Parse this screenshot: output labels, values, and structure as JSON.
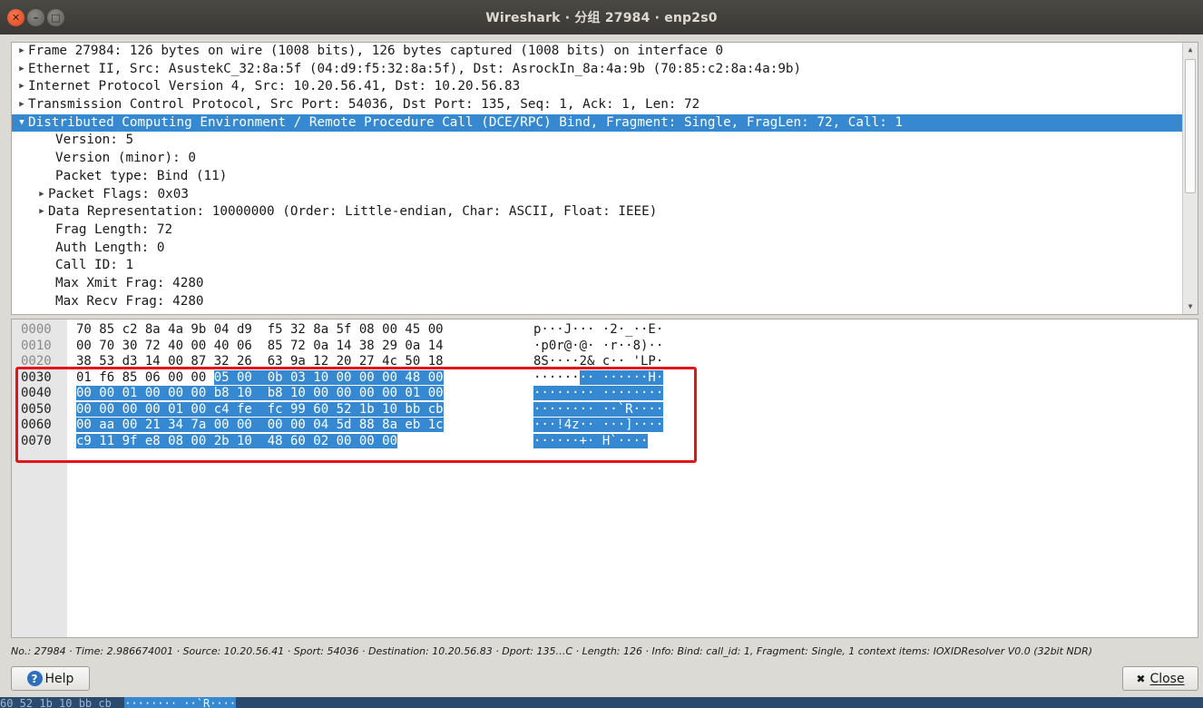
{
  "window": {
    "title": "Wireshark · 分组 27984 · enp2s0"
  },
  "tree": {
    "rows": [
      {
        "level": 0,
        "expander": "collapsed",
        "text": "Frame 27984: 126 bytes on wire (1008 bits), 126 bytes captured (1008 bits) on interface 0"
      },
      {
        "level": 0,
        "expander": "collapsed",
        "text": "Ethernet II, Src: AsustekC_32:8a:5f (04:d9:f5:32:8a:5f), Dst: AsrockIn_8a:4a:9b (70:85:c2:8a:4a:9b)"
      },
      {
        "level": 0,
        "expander": "collapsed",
        "text": "Internet Protocol Version 4, Src: 10.20.56.41, Dst: 10.20.56.83"
      },
      {
        "level": 0,
        "expander": "collapsed",
        "text": "Transmission Control Protocol, Src Port: 54036, Dst Port: 135, Seq: 1, Ack: 1, Len: 72"
      },
      {
        "level": 0,
        "expander": "expanded",
        "selected": true,
        "text": "Distributed Computing Environment / Remote Procedure Call (DCE/RPC) Bind, Fragment: Single, FragLen: 72, Call: 1"
      },
      {
        "level": 1,
        "expander": "none",
        "text": "Version: 5"
      },
      {
        "level": 1,
        "expander": "none",
        "text": "Version (minor): 0"
      },
      {
        "level": 1,
        "expander": "none",
        "text": "Packet type: Bind (11)"
      },
      {
        "level": 1,
        "expander": "collapsed",
        "text": "Packet Flags: 0x03"
      },
      {
        "level": 1,
        "expander": "collapsed",
        "text": "Data Representation: 10000000 (Order: Little-endian, Char: ASCII, Float: IEEE)"
      },
      {
        "level": 1,
        "expander": "none",
        "text": "Frag Length: 72"
      },
      {
        "level": 1,
        "expander": "none",
        "text": "Auth Length: 0"
      },
      {
        "level": 1,
        "expander": "none",
        "text": "Call ID: 1"
      },
      {
        "level": 1,
        "expander": "none",
        "text": "Max Xmit Frag: 4280"
      },
      {
        "level": 1,
        "expander": "none",
        "text": "Max Recv Frag: 4280"
      }
    ]
  },
  "hex": {
    "rows": [
      {
        "offset": "0000",
        "bytes_plain": "70 85 c2 8a 4a 9b 04 d9  f5 32 8a 5f 08 00 45 00",
        "bytes_hl": "",
        "ascii_plain": "p···J··· ·2·_··E·",
        "ascii_hl": ""
      },
      {
        "offset": "0010",
        "bytes_plain": "00 70 30 72 40 00 40 06  85 72 0a 14 38 29 0a 14",
        "bytes_hl": "",
        "ascii_plain": "·p0r@·@· ·r··8)··",
        "ascii_hl": ""
      },
      {
        "offset": "0020",
        "bytes_plain": "38 53 d3 14 00 87 32 26  63 9a 12 20 27 4c 50 18",
        "bytes_hl": "",
        "ascii_plain": "8S····2& c·· 'LP·",
        "ascii_hl": ""
      },
      {
        "offset": "0030",
        "bytes_plain": "01 f6 85 06 00 00 ",
        "bytes_hl": "05 00  0b 03 10 00 00 00 48 00",
        "ascii_plain": "······",
        "ascii_hl": "·· ······H·"
      },
      {
        "offset": "0040",
        "bytes_plain": "",
        "bytes_hl": "00 00 01 00 00 00 b8 10  b8 10 00 00 00 00 01 00",
        "ascii_plain": "",
        "ascii_hl": "········ ········"
      },
      {
        "offset": "0050",
        "bytes_plain": "",
        "bytes_hl": "00 00 00 00 01 00 c4 fe  fc 99 60 52 1b 10 bb cb",
        "ascii_plain": "",
        "ascii_hl": "········ ··`R····"
      },
      {
        "offset": "0060",
        "bytes_plain": "",
        "bytes_hl": "00 aa 00 21 34 7a 00 00  00 00 04 5d 88 8a eb 1c",
        "ascii_plain": "",
        "ascii_hl": "···!4z·· ···]····"
      },
      {
        "offset": "0070",
        "bytes_plain": "",
        "bytes_hl": "c9 11 9f e8 08 00 2b 10  48 60 02 00 00 00",
        "ascii_plain": "",
        "ascii_hl": "······+· H`····"
      }
    ]
  },
  "status": {
    "info": "No.: 27984 · Time: 2.986674001 · Source: 10.20.56.41 · Sport: 54036 · Destination: 10.20.56.83 · Dport: 135…C · Length: 126 · Info: Bind: call_id: 1, Fragment: Single, 1 context items: IOXIDResolver V0.0 (32bit NDR)"
  },
  "buttons": {
    "help_label": "Help",
    "close_label": "Close"
  },
  "behind": {
    "text_plain": "60 52 1b 10 bb cb  ",
    "text_hl": "········ ··`R····"
  },
  "colors": {
    "selection": "#3689d0",
    "annotation_box": "#e3151a"
  },
  "icons": {
    "expander_collapsed": "triangle-right-icon",
    "expander_expanded": "triangle-down-icon",
    "help": "question-circle-icon",
    "close": "x-icon"
  }
}
